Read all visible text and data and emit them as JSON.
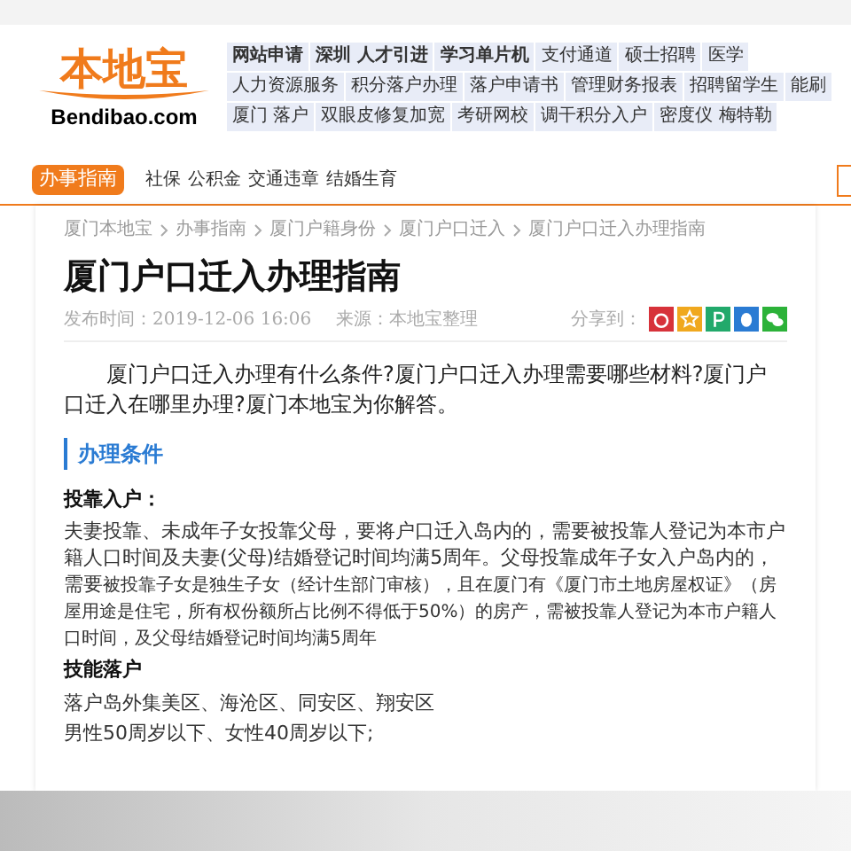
{
  "logo": {
    "name": "本地宝",
    "domain": "Bendibao.com"
  },
  "nav_rows": [
    {
      "links": [
        {
          "label": "网站申请",
          "bold": true
        },
        {
          "label": "深圳 人才引进",
          "bold": true
        },
        {
          "label": "学习单片机",
          "bold": true
        },
        {
          "label": "支付通道",
          "bold": false
        },
        {
          "label": "硕士招聘",
          "bold": false
        },
        {
          "label": "医学",
          "bold": false
        }
      ]
    },
    {
      "links": [
        {
          "label": "人力资源服务",
          "bold": false
        },
        {
          "label": "积分落户办理",
          "bold": false
        },
        {
          "label": "落户申请书",
          "bold": false
        },
        {
          "label": "管理财务报表",
          "bold": false
        },
        {
          "label": "招聘留学生",
          "bold": false
        },
        {
          "label": "能刷",
          "bold": false
        }
      ]
    },
    {
      "links": [
        {
          "label": "厦门 落户",
          "bold": false
        },
        {
          "label": "双眼皮修复加宽",
          "bold": false
        },
        {
          "label": "考研网校",
          "bold": false
        },
        {
          "label": "调干积分入户",
          "bold": false
        },
        {
          "label": "密度仪 梅特勒",
          "bold": false
        }
      ]
    }
  ],
  "channel": {
    "title": "办事指南",
    "links": [
      "社保",
      "公积金",
      "交通违章",
      "结婚生育"
    ]
  },
  "breadcrumb": [
    "厦门本地宝",
    "办事指南",
    "厦门户籍身份",
    "厦门户口迁入",
    "厦门户口迁入办理指南"
  ],
  "article": {
    "title": "厦门户口迁入办理指南",
    "published": "发布时间：2019-12-06 16:06",
    "source": "来源：本地宝整理",
    "share_label": "分享到：",
    "share": [
      {
        "kind": "weibo",
        "color": "#d7323a"
      },
      {
        "kind": "star",
        "color": "#f0a81e"
      },
      {
        "kind": "p",
        "color": "#22a96b"
      },
      {
        "kind": "qq",
        "color": "#2a7bd3"
      },
      {
        "kind": "wechat",
        "color": "#2cb239"
      }
    ],
    "intro": "厦门户口迁入办理有什么条件?厦门户口迁入办理需要哪些材料?厦门户口迁入在哪里办理?厦门本地宝为你解答。",
    "section": "办理条件",
    "blocks": [
      {
        "kind": "heading",
        "text": "投靠入户："
      },
      {
        "kind": "para",
        "text": "夫妻投靠、未成年子女投靠父母，要将户口迁入岛内的，需要被投靠人登记为本市户籍人口时间及夫妻(父母)结婚登记时间均满5周年。父母投靠成年子女入户岛内的，需要",
        "small": "被投靠子女是独生子女（经计生部门审核），且在厦门有《厦门市土地房屋权证》（房屋用途是住宅，所有权份额所占比例不得低于50%）的房产，需被投靠人登记为本市户籍人口时间，及父母结婚登记时间均满5周年"
      },
      {
        "kind": "heading",
        "text": "技能落户"
      },
      {
        "kind": "para",
        "text": "落户岛外集美区、海沧区、同安区、翔安区"
      },
      {
        "kind": "para",
        "text": "男性50周岁以下、女性40周岁以下;"
      }
    ]
  }
}
